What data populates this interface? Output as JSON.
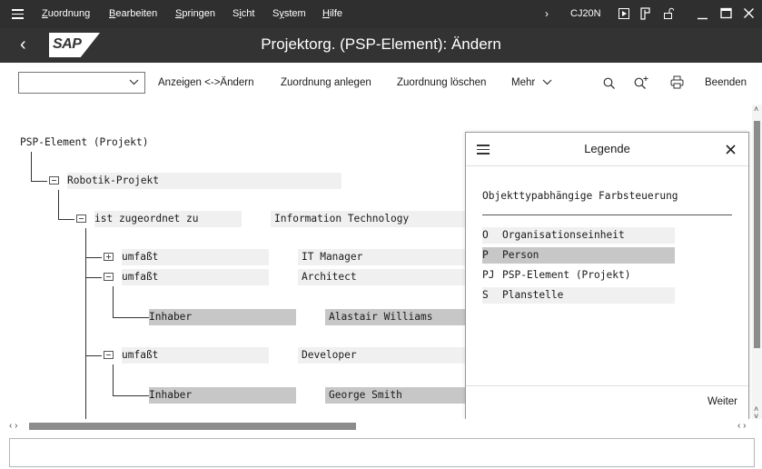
{
  "menubar": {
    "items": [
      "Zuordnung",
      "Bearbeiten",
      "Springen",
      "Sicht",
      "System",
      "Hilfe"
    ],
    "underline": [
      "Z",
      "B",
      "S",
      "i",
      "y",
      "H"
    ],
    "tcode": "CJ20N"
  },
  "titlebar": {
    "title": "Projektorg. (PSP-Element): Ändern",
    "logo": "SAP"
  },
  "toolbar": {
    "dropdown_value": "",
    "buttons": [
      "Anzeigen <->Ändern",
      "Zuordnung anlegen",
      "Zuordnung löschen",
      "Mehr"
    ],
    "exit_label": "Beenden"
  },
  "tree": {
    "root": "PSP-Element (Projekt)",
    "project": "Robotik-Projekt",
    "assignment_rel": "ist zugeordnet zu",
    "assignment_target": "Information Technology",
    "rows": [
      {
        "rel": "umfaßt",
        "target": "IT Manager"
      },
      {
        "rel": "umfaßt",
        "target": "Architect"
      },
      {
        "rel": "Inhaber",
        "target": "Alastair Williams"
      },
      {
        "rel": "umfaßt",
        "target": "Developer"
      },
      {
        "rel": "Inhaber",
        "target": "George Smith"
      }
    ]
  },
  "legend": {
    "title": "Legende",
    "subtitle": "Objekttypabhängige Farbsteuerung",
    "entries": [
      {
        "code": "O",
        "name": "Organisationseinheit"
      },
      {
        "code": "P",
        "name": "Person"
      },
      {
        "code": "PJ",
        "name": "PSP-Element (Projekt)"
      },
      {
        "code": "S",
        "name": "Planstelle"
      }
    ],
    "weiter": "Weiter"
  },
  "colors": {
    "menubar_bg": "#2f2f2f",
    "titlebar_bg": "#333333",
    "row_light": "#f0f0f0",
    "row_dark": "#c7c7c7"
  },
  "icons": [
    "menu-icon",
    "back-icon",
    "execute-icon",
    "layout-icon",
    "lock-icon",
    "minimize-icon",
    "maximize-icon",
    "close-icon",
    "search-icon",
    "search-next-icon",
    "print-icon",
    "folder-open-icon",
    "folder-closed-icon"
  ]
}
